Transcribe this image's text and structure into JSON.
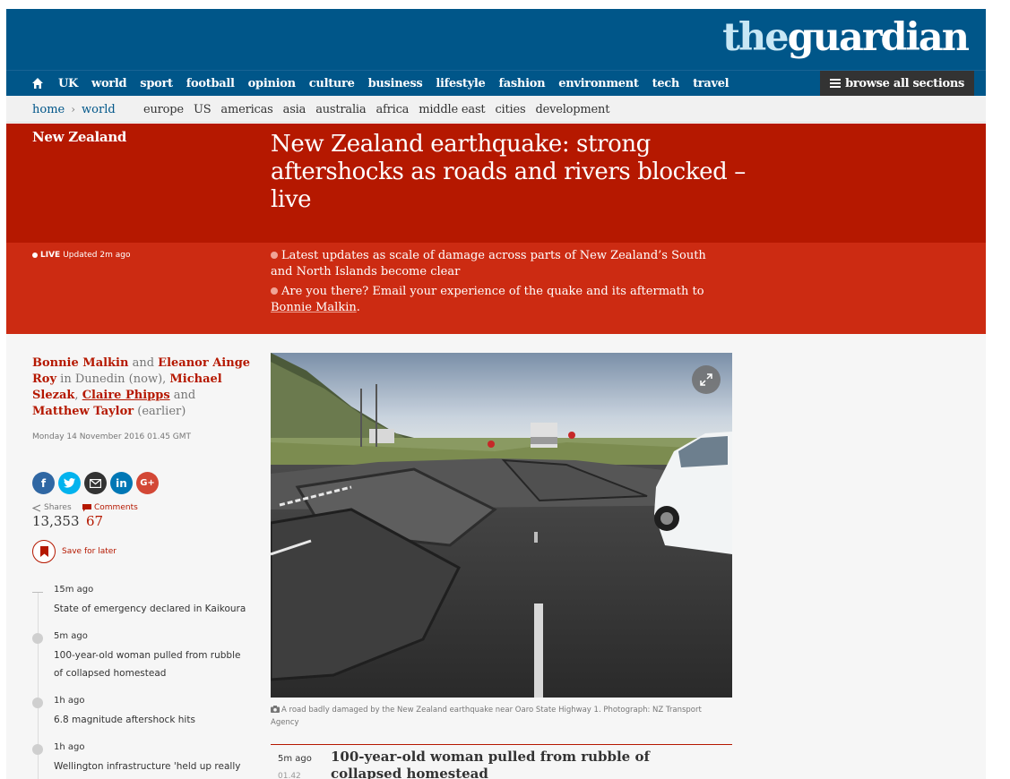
{
  "brand": {
    "logo_the": "the",
    "logo_guardian": "guardian",
    "color": "#005689"
  },
  "nav": {
    "home_icon": "home-icon",
    "items": [
      "UK",
      "world",
      "sport",
      "football",
      "opinion",
      "culture",
      "business",
      "lifestyle",
      "fashion",
      "environment",
      "tech",
      "travel"
    ],
    "browse_label": "browse all sections"
  },
  "subnav": {
    "crumbs": [
      "home",
      "world"
    ],
    "items": [
      "europe",
      "US",
      "americas",
      "asia",
      "australia",
      "africa",
      "middle east",
      "cities",
      "development"
    ]
  },
  "article": {
    "section": "New Zealand",
    "headline": "New Zealand earthquake: strong aftershocks as roads and rivers blocked – live",
    "live_label": "LIVE",
    "updated": "Updated 2m ago",
    "standfirst": [
      {
        "text": "Latest updates as scale of damage across parts of New Zealand’s South and North Islands become clear"
      },
      {
        "text": "Are you there? Email your experience of the quake and its aftermath to ",
        "link": "Bonnie Malkin",
        "after": "."
      }
    ],
    "accent_color": "#b51800"
  },
  "byline": {
    "author1": "Bonnie Malkin",
    "and1": " and ",
    "author2": "Eleanor Ainge Roy",
    "loc1": " in Dunedin (now), ",
    "author3": "Michael Slezak",
    "comma": ", ",
    "author4": "Claire Phipps",
    "and2": " and ",
    "author5": "Matthew Taylor",
    "loc2": " (earlier)",
    "date": "Monday 14 November 2016 01.45 GMT"
  },
  "share": {
    "buttons": [
      {
        "icon": "facebook-icon",
        "glyph": "f",
        "color": "#3067a3"
      },
      {
        "icon": "twitter-icon",
        "glyph": "t",
        "color": "#03b3ee"
      },
      {
        "icon": "email-icon",
        "glyph": "✉",
        "color": "#333333"
      },
      {
        "icon": "linkedin-icon",
        "glyph": "in",
        "color": "#0077b5"
      },
      {
        "icon": "googleplus-icon",
        "glyph": "G+",
        "color": "#d34836"
      }
    ],
    "shares_label": "Shares",
    "shares_count": "13,353",
    "comments_label": "Comments",
    "comments_count": "67",
    "save_label": "Save for later"
  },
  "timeline": [
    {
      "time": "15m ago",
      "text": "State of emergency declared in Kaikoura"
    },
    {
      "time": "5m ago",
      "text": "100-year-old woman pulled from rubble of collapsed homestead"
    },
    {
      "time": "1h ago",
      "text": "6.8 magnitude aftershock hits"
    },
    {
      "time": "1h ago",
      "text": "Wellington infrastructure 'held up really"
    }
  ],
  "figure": {
    "caption": "A road badly damaged by the New Zealand earthquake near Oaro State Highway 1. Photograph: NZ Transport Agency",
    "camera_icon": "camera-icon",
    "expand_icon": "expand-icon"
  },
  "first_post": {
    "time": "5m ago",
    "clock": "01.42",
    "title": "100-year-old woman pulled from rubble of collapsed homestead"
  }
}
